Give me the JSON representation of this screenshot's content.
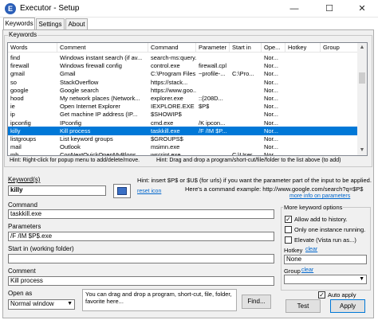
{
  "window": {
    "title": "Executor - Setup",
    "app_icon": "E"
  },
  "controls": {
    "minimize": "—",
    "maximize": "☐",
    "close": "✕"
  },
  "tabs": [
    "Keywords",
    "Settings",
    "About"
  ],
  "keywords_group": {
    "label": "Keywords"
  },
  "columns": [
    "Words",
    "Comment",
    "Command",
    "Parameter",
    "Start in",
    "Ope...",
    "Hotkey",
    "Group"
  ],
  "rows": [
    [
      "find",
      "Windows instant search (if av...",
      "search-ms:query...",
      "",
      "",
      "Nor...",
      "",
      ""
    ],
    [
      "firewall",
      "Windows firewall config",
      "control.exe",
      "firewall.cpl",
      "",
      "Nor...",
      "",
      ""
    ],
    [
      "gmail",
      "Gmail",
      "C:\\Program Files...",
      "~profile-...",
      "C:\\Pro...",
      "Nor...",
      "",
      ""
    ],
    [
      "so",
      "StackOverflow",
      "https://stack...",
      "",
      "",
      "Nor...",
      "",
      ""
    ],
    [
      "google",
      "Google search",
      "https://www.goo...",
      "",
      "",
      "Nor...",
      "",
      ""
    ],
    [
      "hood",
      "My network places (Network...",
      "explorer.exe",
      "::{208D...",
      "",
      "Nor...",
      "",
      ""
    ],
    [
      "ie",
      "Open Internet Explorer",
      "IEXPLORE.EXE",
      "$P$",
      "",
      "Nor...",
      "",
      ""
    ],
    [
      "ip",
      "Get machine IP address (IP...",
      "$SHOWIP$",
      "",
      "",
      "Nor...",
      "",
      ""
    ],
    [
      "ipconfig",
      "IPconfig",
      "cmd.exe",
      "/K ipcon...",
      "",
      "Nor...",
      "",
      ""
    ],
    [
      "killy",
      "Kill process",
      "taskkill.exe",
      "/F /IM $P...",
      "",
      "Nor...",
      "",
      ""
    ],
    [
      "listgroups",
      "List keyword groups",
      "$GROUPS$",
      "",
      "",
      "Nor...",
      "",
      ""
    ],
    [
      "mail",
      "Outlook",
      "msimn.exe",
      "",
      "",
      "Nor...",
      "",
      ""
    ],
    [
      "mb",
      "ConNextQuickOpenMyBlogs",
      "wscript.exe",
      "",
      "C:\\User...",
      "Nor...",
      "",
      ""
    ]
  ],
  "list_hint": "Hint: Right-click for popup menu to add/delete/move.",
  "list_hint_right": "Hint: Drag and drop a program/short-cut/file/folder to the list above (to add)",
  "form": {
    "keyword_label": "Keyword(s)",
    "keyword_value": "killy",
    "reset_icon": "reset icon",
    "hint_insert": "Hint: insert $P$ or $U$ (for urls) if you want the parameter part of the input to be applied.",
    "hint_example": "Here's a command example: http://www.google.com/search?q=$P$",
    "more_info": "more info on parameters",
    "command_label": "Command",
    "command_value": "taskkill.exe",
    "parameters_label": "Parameters",
    "parameters_value": "/F /IM $P$.exe",
    "startin_label": "Start in (working folder)",
    "startin_value": "",
    "comment_label": "Comment",
    "comment_value": "Kill process",
    "openas_label": "Open as",
    "openas_value": "Normal window",
    "drop_hint": "You can drag and drop a program, short-cut, file, folder, favorite here...",
    "find_button": "Find..."
  },
  "options": {
    "group_label": "More keyword options",
    "allow_history": "Allow add to history.",
    "allow_history_checked": true,
    "one_instance": "Only one instance running.",
    "one_instance_checked": false,
    "elevate": "Elevate (Vista run as...)",
    "elevate_checked": false,
    "hotkey_label": "Hotkey",
    "hotkey_clear": "clear",
    "hotkey_value": "None",
    "group_field_label": "Group",
    "group_clear": "clear",
    "group_value": ""
  },
  "bottom": {
    "auto_apply": "Auto apply",
    "auto_apply_checked": true,
    "test_button": "Test",
    "apply_button": "Apply"
  },
  "colors": {
    "selection": "#0078d7",
    "link": "#0066cc",
    "accent_icon": "#2b5fb8"
  }
}
